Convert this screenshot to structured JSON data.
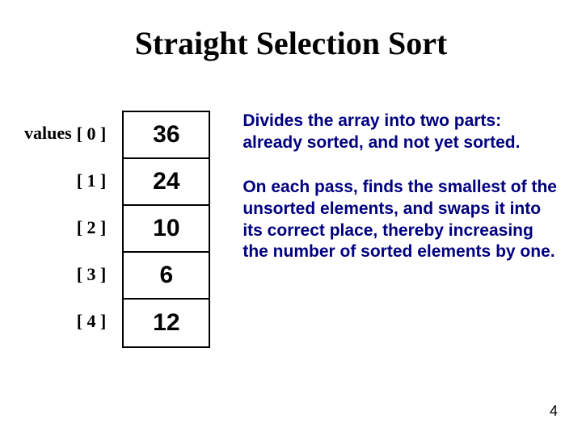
{
  "title": "Straight Selection Sort",
  "valuesLabel": "values",
  "indices": {
    "i0": "[ 0 ]",
    "i1": "[ 1 ]",
    "i2": "[ 2 ]",
    "i3": "[ 3 ]",
    "i4": "[ 4 ]"
  },
  "cells": {
    "c0": "36",
    "c1": "24",
    "c2": "10",
    "c3": "6",
    "c4": "12"
  },
  "para1": "Divides the array into two parts:  already sorted, and not yet sorted.",
  "para2": "On each pass, finds the smallest of the unsorted elements, and swaps it into its correct place, thereby increasing the number of sorted elements by one.",
  "pageNumber": "4",
  "chart_data": {
    "type": "table",
    "title": "Straight Selection Sort",
    "categories": [
      "[0]",
      "[1]",
      "[2]",
      "[3]",
      "[4]"
    ],
    "values": [
      36,
      24,
      10,
      6,
      12
    ]
  }
}
